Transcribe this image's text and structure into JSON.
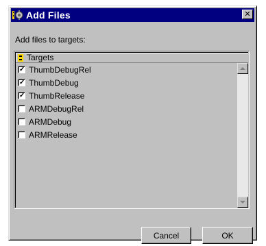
{
  "window": {
    "title": "Add Files",
    "close_glyph": "✕",
    "icon": "app-icon"
  },
  "prompt": "Add files to targets:",
  "list": {
    "header": "Targets",
    "header_icon": "target-icon",
    "items": [
      {
        "label": "ThumbDebugRel",
        "checked": true
      },
      {
        "label": "ThumbDebug",
        "checked": true
      },
      {
        "label": "ThumbRelease",
        "checked": true
      },
      {
        "label": "ARMDebugRel",
        "checked": false
      },
      {
        "label": "ARMDebug",
        "checked": false
      },
      {
        "label": "ARMRelease",
        "checked": false
      }
    ]
  },
  "buttons": {
    "cancel": "Cancel",
    "ok": "OK"
  }
}
